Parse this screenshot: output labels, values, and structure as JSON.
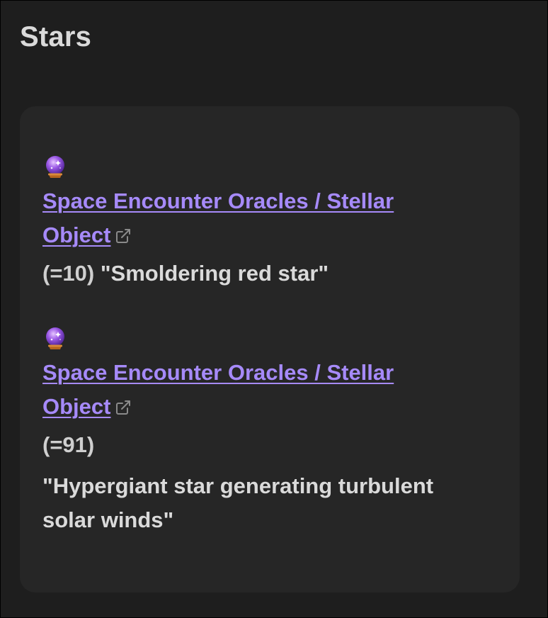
{
  "page": {
    "title": "Stars"
  },
  "entries": [
    {
      "icon": "crystal-ball-icon",
      "link_text": "Space Encounter Oracles / Stellar Object",
      "roll": "(=10)",
      "result": "\"Smoldering red star\""
    },
    {
      "icon": "crystal-ball-icon",
      "link_text": "Space Encounter Oracles / Stellar Object",
      "roll": "(=91)",
      "result": "\"Hypergiant star generating turbulent solar winds\""
    }
  ],
  "colors": {
    "background": "#1e1e1e",
    "card": "#262626",
    "link": "#a68af9",
    "text": "#dadada"
  }
}
